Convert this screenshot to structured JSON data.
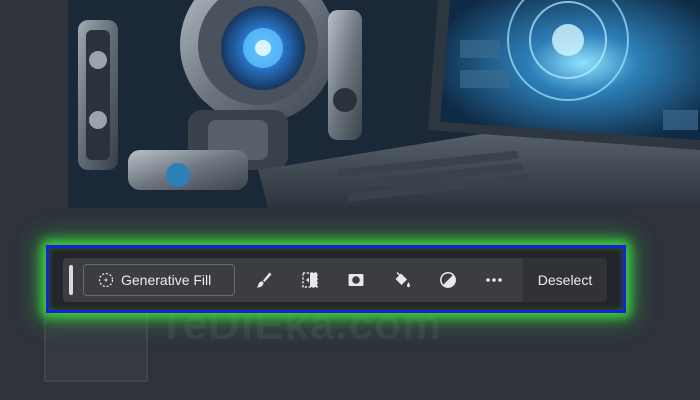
{
  "canvas": {
    "image_subject": "robot-with-laptop"
  },
  "watermark": {
    "text": "TeDiEka.com"
  },
  "taskbar": {
    "highlight_color": "#38d63a",
    "frame_color": "#1b1fd9",
    "generative_fill_label": "Generative Fill",
    "tools": [
      {
        "name": "brush-icon"
      },
      {
        "name": "select-transform-icon"
      },
      {
        "name": "mask-icon"
      },
      {
        "name": "paint-bucket-icon"
      },
      {
        "name": "adjustment-icon"
      },
      {
        "name": "more-icon"
      }
    ],
    "deselect_label": "Deselect"
  }
}
